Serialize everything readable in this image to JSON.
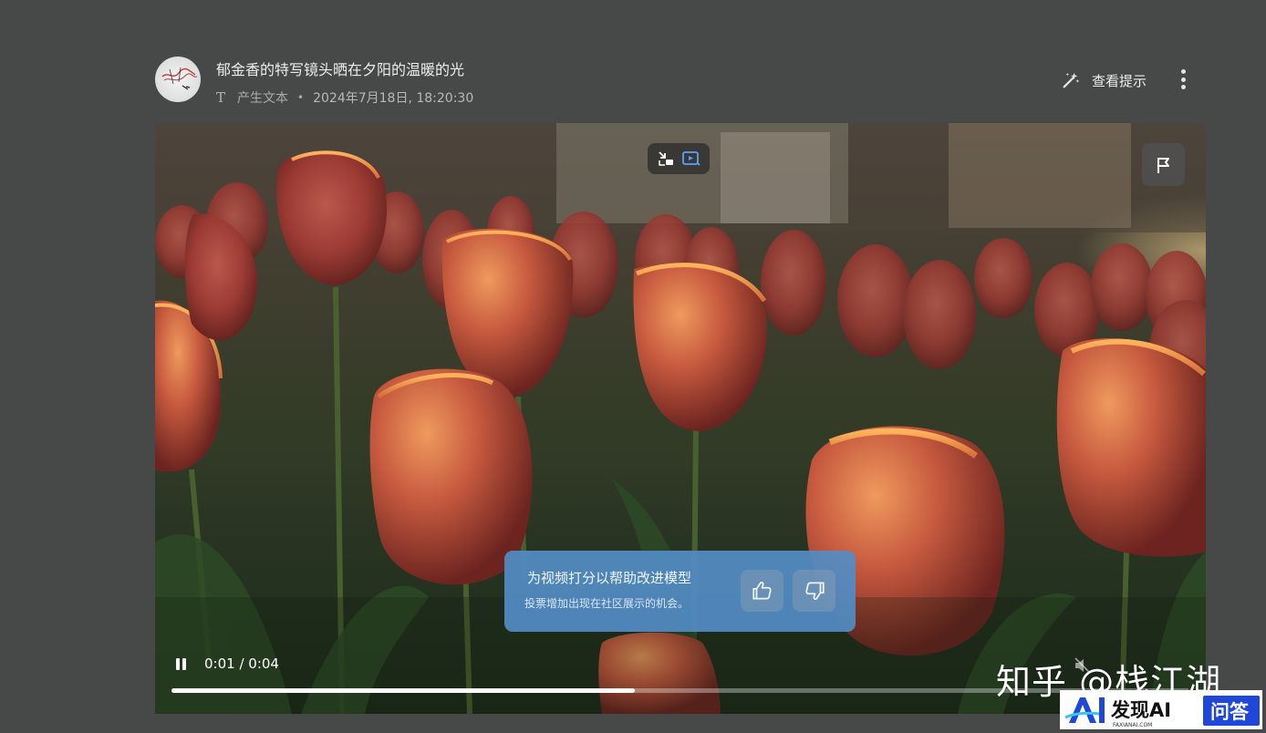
{
  "post": {
    "title": "郁金香的特写镜头晒在夕阳的温暖的光",
    "type_icon": "T",
    "type_label": "产生文本",
    "separator": "•",
    "datetime": "2024年7月18日, 18:20:30"
  },
  "toolbar": {
    "hint_label": "查看提示",
    "hint_icon": "magic-wand-icon",
    "more_icon": "more-vertical-icon"
  },
  "player": {
    "top_controls": [
      "exit-fullscreen-icon",
      "video-icon"
    ],
    "flag_icon": "flag-icon",
    "time_display": "0:01 / 0:04",
    "progress_fraction": 0.455,
    "state": "playing",
    "muted": true
  },
  "feedback": {
    "title": "为视频打分以帮助改进模型",
    "subtitle": "投票增加出现在社区展示的机会。",
    "up_icon": "thumbs-up-icon",
    "down_icon": "thumbs-down-icon"
  },
  "watermark": {
    "text": "知乎 @栈江湖",
    "logo_text": "发现AI",
    "logo_ai": "AI",
    "logo_sub": "FAXIANAI.COM",
    "logo_badge": "问答"
  },
  "colors": {
    "page_bg": "#474948",
    "feedback_bg": "#528cc4",
    "logo_blue": "#1f47d8"
  }
}
